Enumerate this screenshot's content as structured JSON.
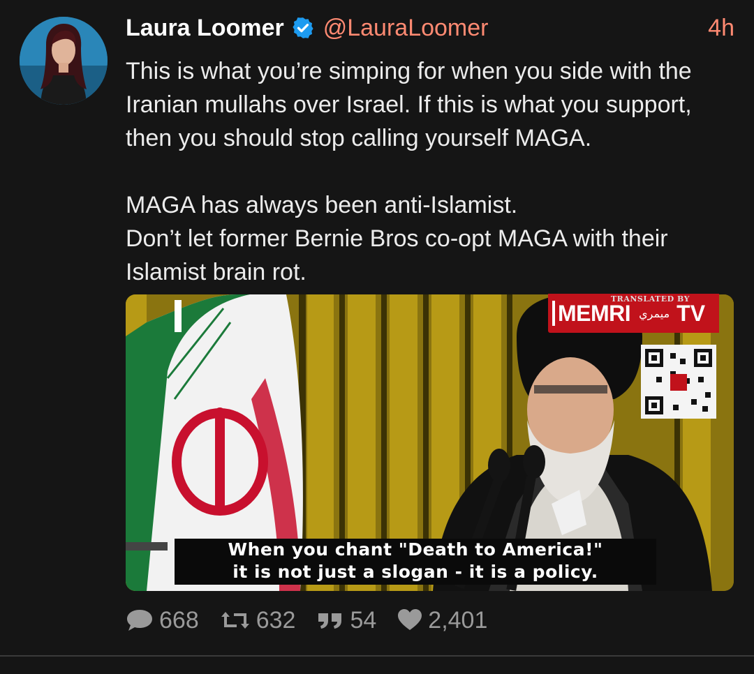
{
  "author": {
    "name": "Laura Loomer",
    "handle": "@LauraLoomer",
    "time": "4h",
    "verified": true
  },
  "tweet": {
    "text": "This is what you’re simping for when you side with the Iranian mullahs over Israel. If this is what you support, then you should stop calling yourself MAGA.\n\nMAGA has always been anti-Islamist.\nDon’t let former Bernie Bros co-opt MAGA with their Islamist brain rot."
  },
  "media": {
    "watermark_top": "TRANSLATED BY",
    "watermark_name": "MEMRI",
    "watermark_arabic": "ميمري",
    "watermark_tv": "TV",
    "subtitle_line1": "When you chant \"Death to America!\"",
    "subtitle_line2": "it is not just a slogan - it is a policy."
  },
  "actions": {
    "replies": "668",
    "retweets": "632",
    "quotes": "54",
    "likes": "2,401"
  },
  "colors": {
    "background": "#151515",
    "accent": "#ff8a72",
    "verified": "#1d9bf0",
    "muted": "#9a9a9a"
  },
  "icons": [
    "verified-badge-icon",
    "reply-icon",
    "retweet-icon",
    "quote-icon",
    "heart-icon"
  ]
}
